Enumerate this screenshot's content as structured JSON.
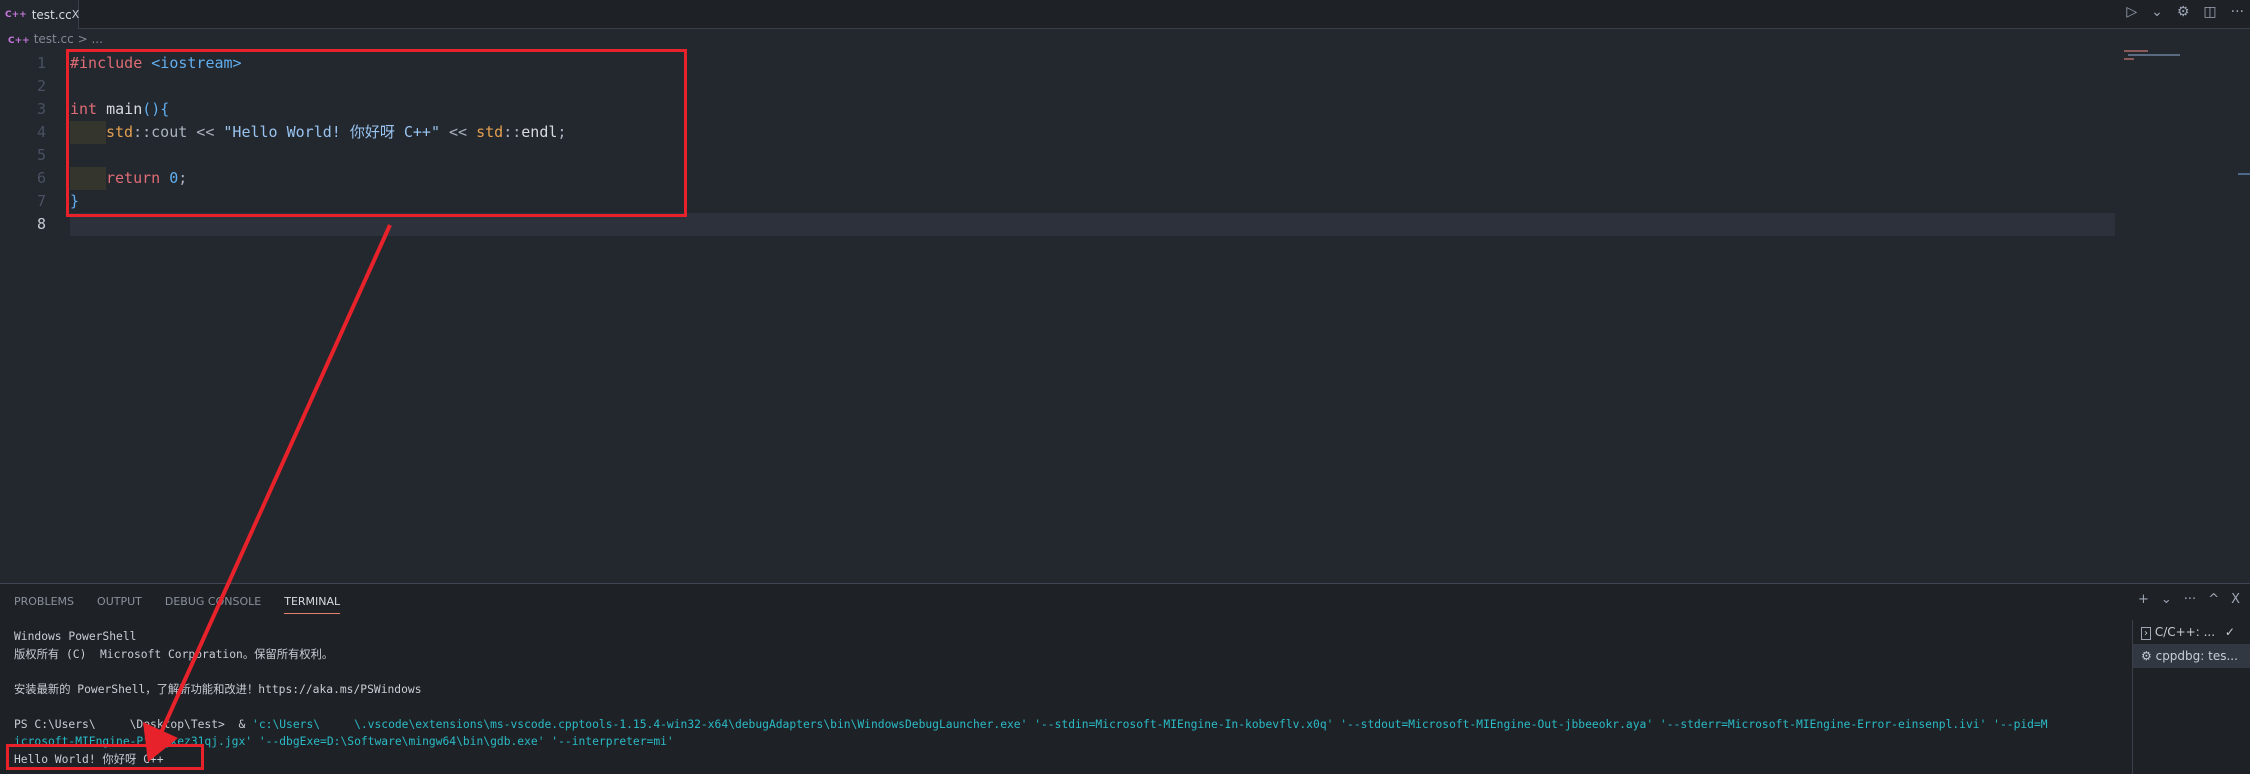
{
  "tab": {
    "icon": "C++",
    "label": "test.cc",
    "close": "X"
  },
  "breadcrumb": {
    "icon": "C++",
    "file": "test.cc",
    "sep": ">",
    "more": "..."
  },
  "actions": {
    "run": "▷",
    "dropdown": "⌄",
    "settings": "⚙",
    "split": "◫",
    "more": "···"
  },
  "editor": {
    "line_numbers": [
      "1",
      "2",
      "3",
      "4",
      "5",
      "6",
      "7",
      "8"
    ],
    "lines": {
      "l1": {
        "kw": "#include",
        "sp": " ",
        "hdr": "<iostream>"
      },
      "l3": {
        "kw": "int",
        "sp": " ",
        "fn": "main",
        "rest": "(){"
      },
      "l4": {
        "ns1": "std",
        "op1": "::cout << ",
        "str": "\"Hello World! 你好呀 C++\"",
        "op2": " << ",
        "ns2": "std",
        "op3": "::",
        "fn": "endl",
        "end": ";"
      },
      "l6": {
        "kw": "return",
        "sp": " ",
        "num": "0",
        "end": ";"
      },
      "l7": {
        "brace": "}"
      }
    }
  },
  "panel": {
    "tabs": [
      "PROBLEMS",
      "OUTPUT",
      "DEBUG CONSOLE",
      "TERMINAL"
    ],
    "actions": {
      "add": "+",
      "dropdown": "⌄",
      "more": "···",
      "maximize": "^",
      "close": "X"
    },
    "terminal": {
      "l1": "Windows PowerShell",
      "l2": "版权所有 (C)  Microsoft Corporation。保留所有权利。",
      "l3": "安装最新的 PowerShell，了解新功能和改进！https://aka.ms/PSWindows",
      "l4_prompt": "PS C:\\Users\\     \\Desktop\\Test>  & ",
      "l4_cmd": "'c:\\Users\\     \\.vscode\\extensions\\ms-vscode.cpptools-1.15.4-win32-x64\\debugAdapters\\bin\\WindowsDebugLauncher.exe' '--stdin=Microsoft-MIEngine-In-kobevflv.x0q' '--stdout=Microsoft-MIEngine-Out-jbbeeokr.aya' '--stderr=Microsoft-MIEngine-Error-einsenpl.ivi' '--pid=M",
      "l5": "icrosoft-MIEngine-Pid-gxez31qj.jgx' '--dbgExe=D:\\Software\\mingw64\\bin\\gdb.exe' '--interpreter=mi'",
      "l6": "Hello World! 你好呀 C++"
    },
    "terminal_list": [
      {
        "icon": "›",
        "label": "C/C++: ...",
        "status": "✓"
      },
      {
        "icon": "⚙",
        "label": "cppdbg: tes..."
      }
    ]
  }
}
